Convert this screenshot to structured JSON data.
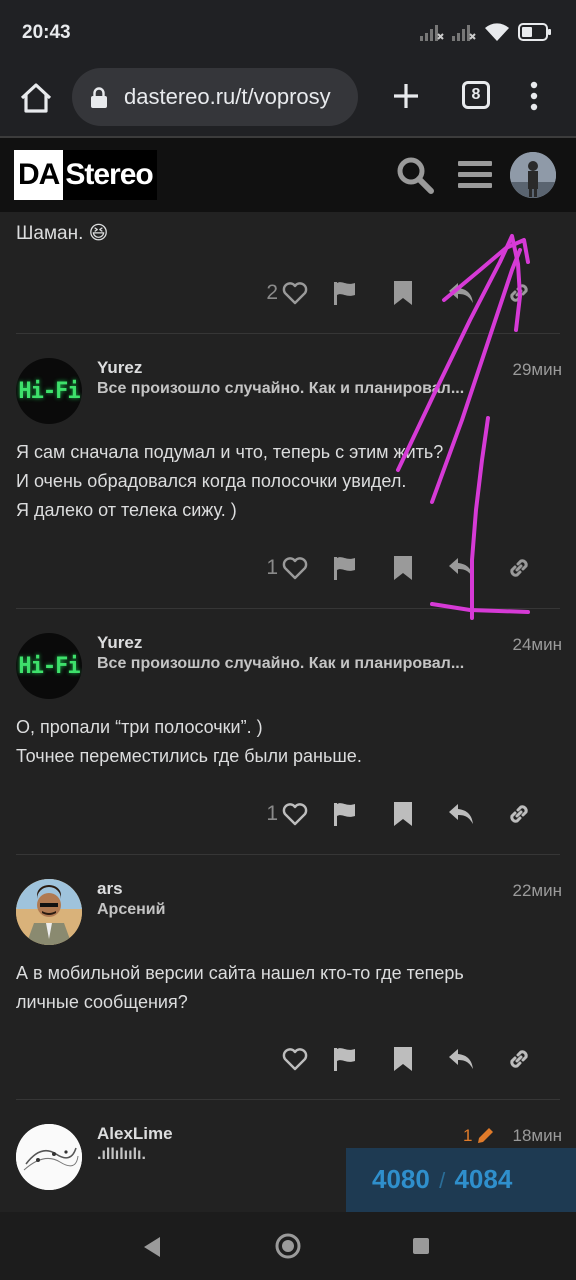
{
  "status": {
    "time": "20:43"
  },
  "browser": {
    "url": "dastereo.ru/t/voprosy",
    "tab_count": "8"
  },
  "site": {
    "logo_da": "DA",
    "logo_stereo": "Stereo"
  },
  "posts": [
    {
      "body": [
        "Шаман. 😆"
      ],
      "likes": "2"
    },
    {
      "username": "Yurez",
      "title": "Все произошло случайно. Как и планировал...",
      "time": "29мин",
      "avatar_text": "Hi-Fi",
      "body": [
        "Я сам сначала подумал и что, теперь с этим жить?",
        "И очень обрадовался когда полосочки увидел.",
        "Я далеко от телека сижу. )"
      ],
      "likes": "1"
    },
    {
      "username": "Yurez",
      "title": "Все произошло случайно. Как и планировал...",
      "time": "24мин",
      "avatar_text": "Hi-Fi",
      "body": [
        "О, пропали “три полосочки”. )",
        "Точнее переместились где были раньше."
      ],
      "likes": "1"
    },
    {
      "username": "ars",
      "title": "Арсений",
      "time": "22мин",
      "body": [
        "А в мобильной версии сайта нашел кто-то где теперь",
        "личные сообщения?"
      ],
      "likes": ""
    },
    {
      "username": "AlexLime",
      "title": ".ıllılıılı.",
      "time": "18мин",
      "edits": "1"
    }
  ],
  "progress": {
    "current": "4080",
    "separator": "/",
    "total": "4084"
  },
  "annotation": {
    "label": "1",
    "color": "#d63ad6"
  }
}
